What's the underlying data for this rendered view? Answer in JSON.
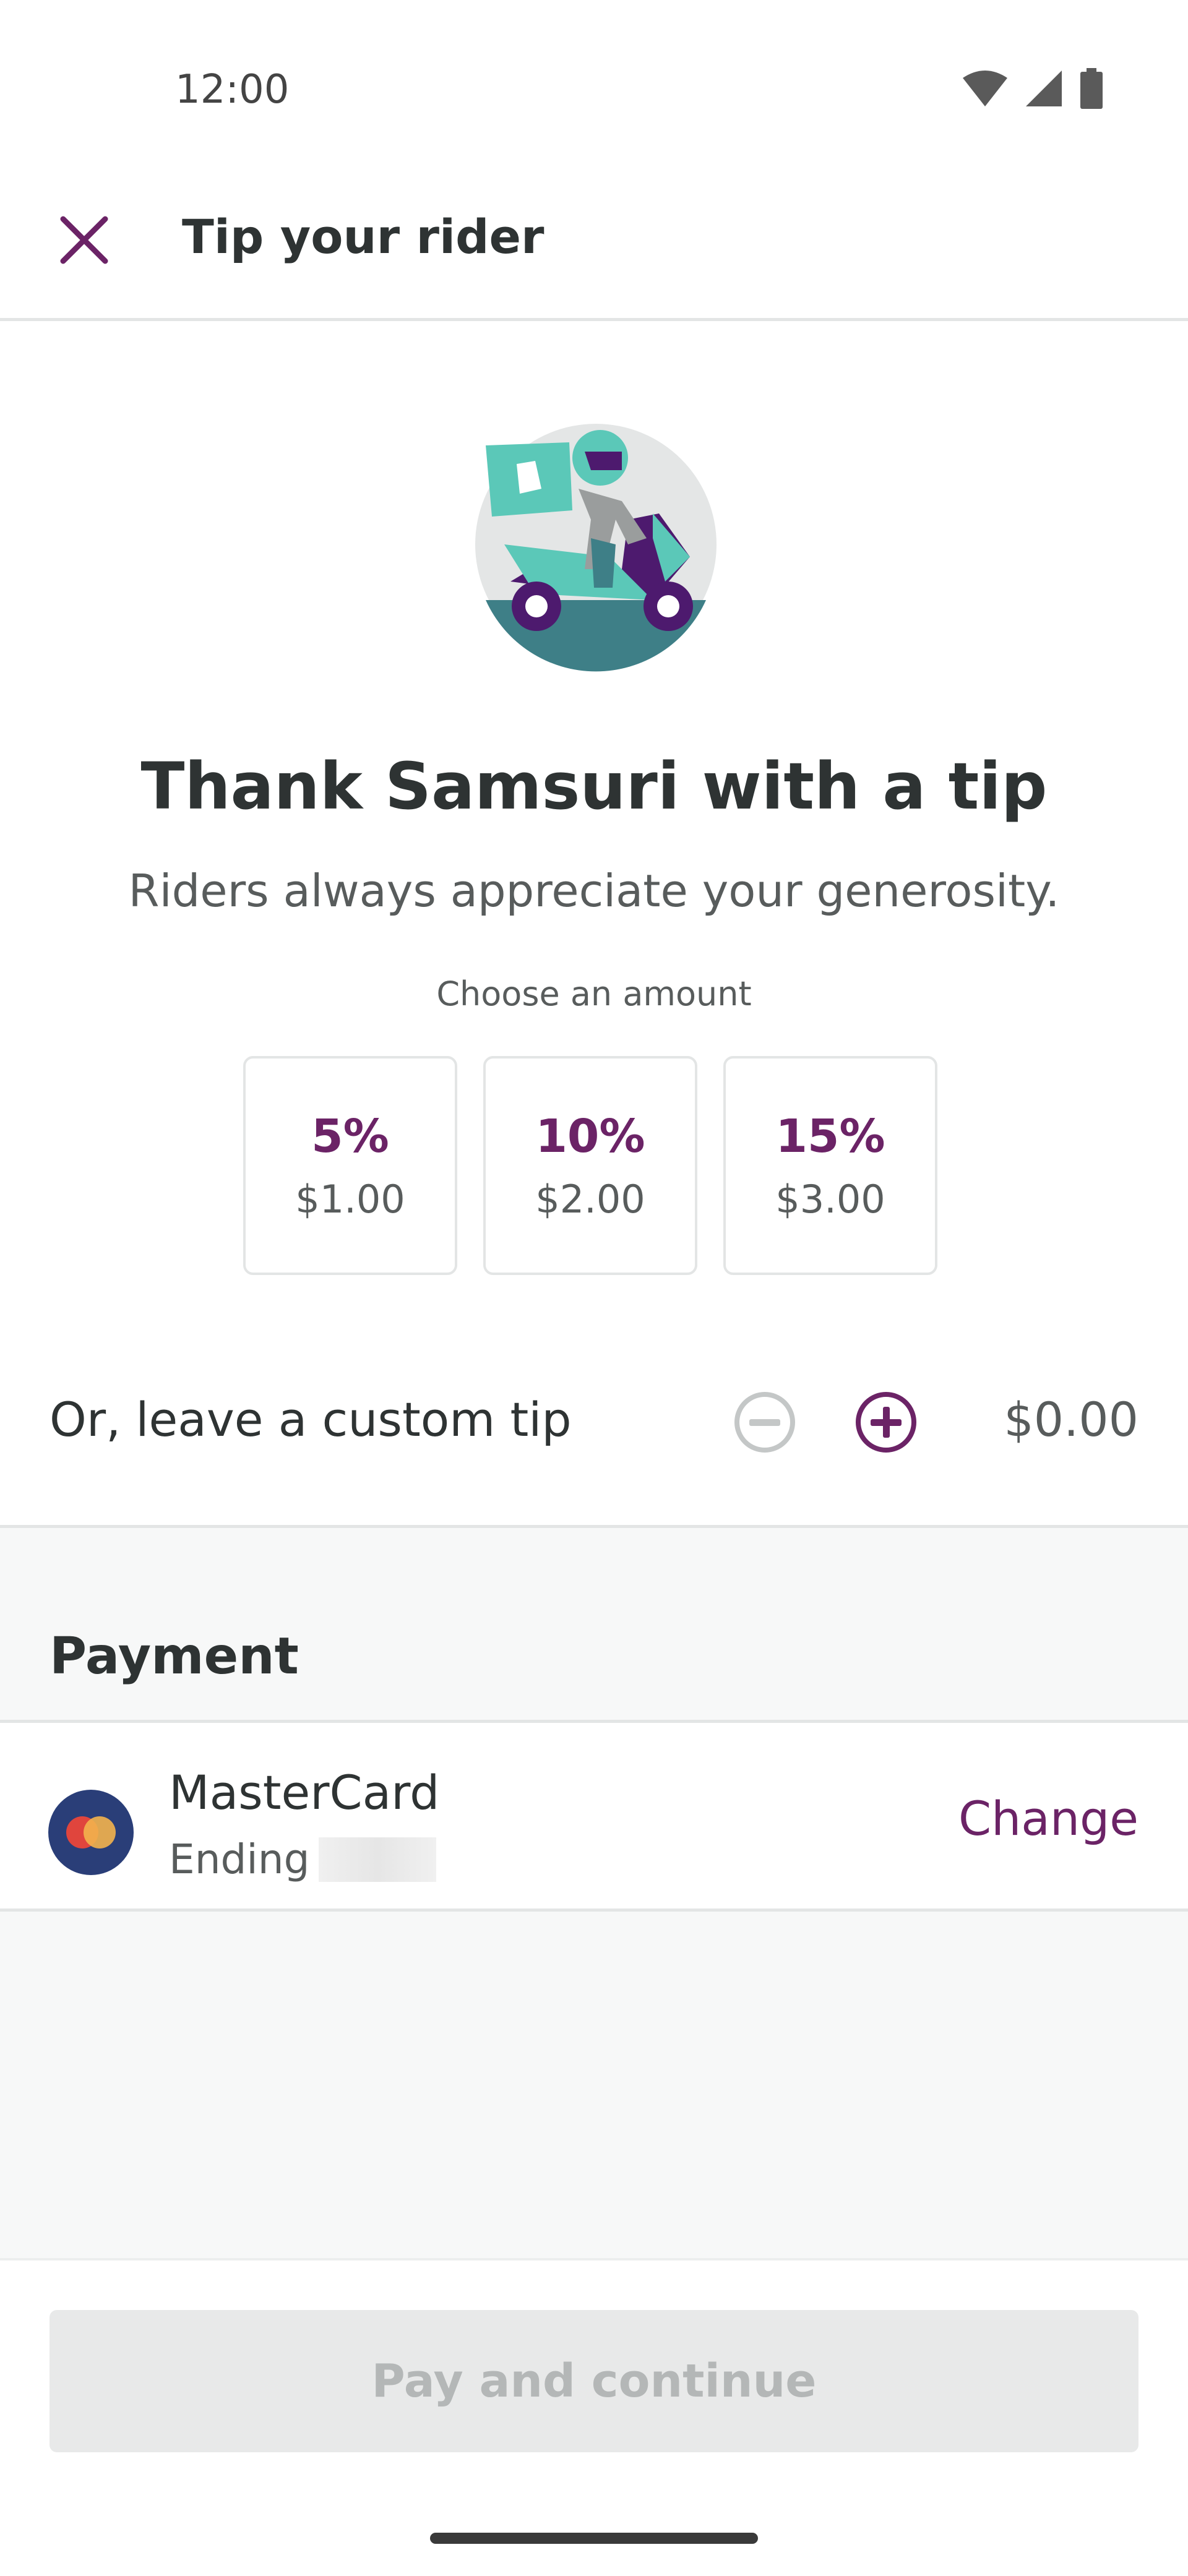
{
  "status_bar": {
    "time": "12:00",
    "icons": [
      "wifi-icon",
      "cellular-signal-icon",
      "battery-icon"
    ]
  },
  "app_bar": {
    "close_icon": "close-icon",
    "title": "Tip your rider"
  },
  "hero": {
    "illustration": "rider-scooter-illustration",
    "headline": "Thank Samsuri with a tip",
    "subline": "Riders always appreciate your generosity."
  },
  "tip": {
    "choose_label": "Choose an amount",
    "options": [
      {
        "percent": "5%",
        "amount": "$1.00"
      },
      {
        "percent": "10%",
        "amount": "$2.00"
      },
      {
        "percent": "15%",
        "amount": "$3.00"
      }
    ],
    "custom_label": "Or, leave a custom tip",
    "custom_amount": "$0.00"
  },
  "payment": {
    "title": "Payment",
    "card_name": "MasterCard",
    "card_ending_label": "Ending",
    "change_label": "Change"
  },
  "footer": {
    "pay_label": "Pay and continue"
  },
  "colors": {
    "accent": "#6b2366",
    "teal": "#5bc8b8",
    "disabled_text": "#b4b7b7",
    "divider": "#e3e5e5"
  }
}
